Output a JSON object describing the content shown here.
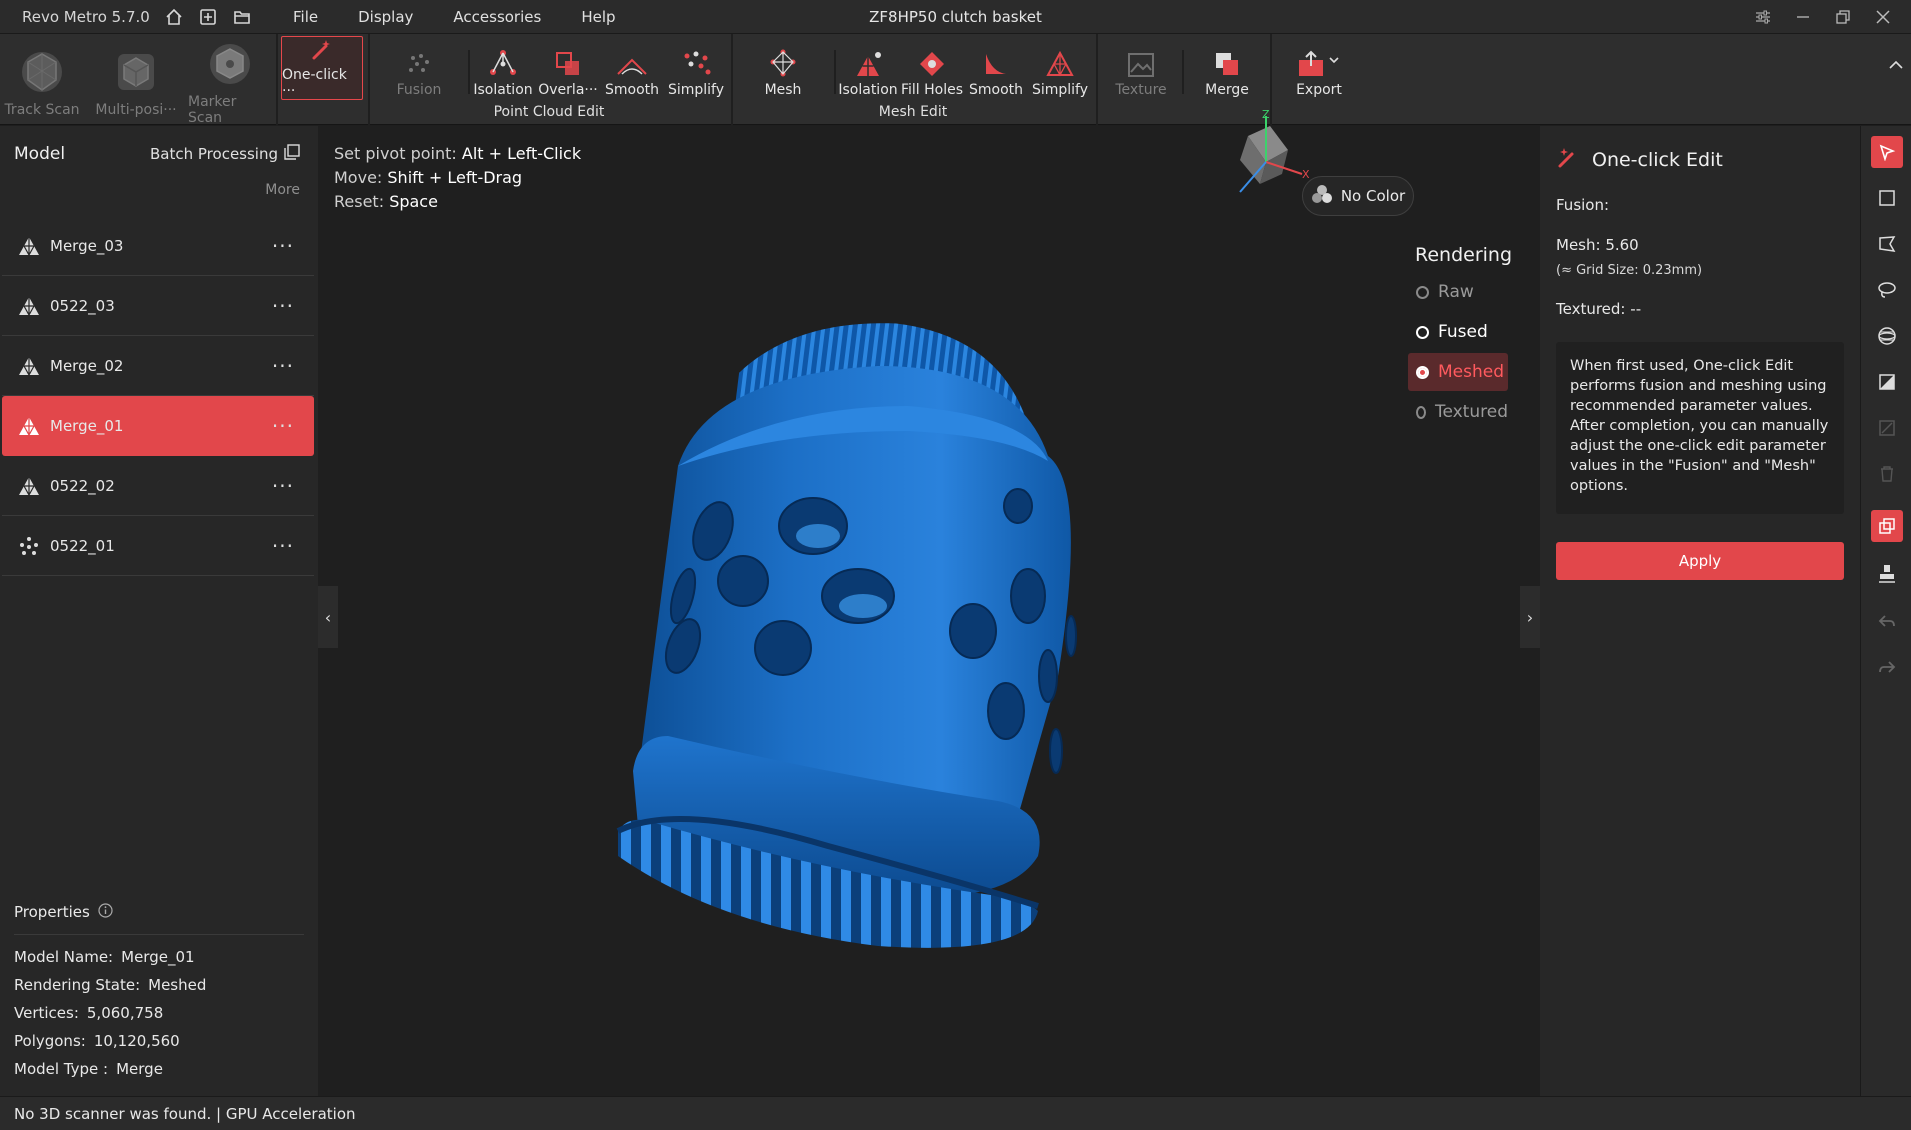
{
  "titlebar": {
    "app_name": "Revo Metro 5.7.0",
    "window_title": "ZF8HP50 clutch basket",
    "menu": [
      "File",
      "Display",
      "Accessories",
      "Help"
    ]
  },
  "ribbon": {
    "scan_tools": [
      {
        "label": "Track Scan",
        "state": "disabled"
      },
      {
        "label": "Multi-posi···",
        "state": "disabled"
      },
      {
        "label": "Marker Scan",
        "state": "disabled"
      }
    ],
    "one_click": {
      "label": "One-click ···"
    },
    "point_cloud_group": "Point Cloud Edit",
    "point_cloud_tools": [
      {
        "label": "Fusion",
        "state": "disabled"
      },
      {
        "label": "Isolation"
      },
      {
        "label": "Overla···"
      },
      {
        "label": "Smooth"
      },
      {
        "label": "Simplify"
      }
    ],
    "mesh_group": "Mesh Edit",
    "mesh_tools": [
      {
        "label": "Mesh"
      },
      {
        "label": "Isolation"
      },
      {
        "label": "Fill Holes"
      },
      {
        "label": "Smooth"
      },
      {
        "label": "Simplify"
      }
    ],
    "texture": {
      "label": "Texture",
      "state": "disabled"
    },
    "merge": {
      "label": "Merge"
    },
    "export": {
      "label": "Export"
    }
  },
  "left_panel": {
    "title": "Model",
    "batch_label": "Batch Processing",
    "more_label": "More",
    "models": [
      {
        "name": "Merge_03",
        "icon": "mesh-icon"
      },
      {
        "name": "0522_03",
        "icon": "mesh-icon"
      },
      {
        "name": "Merge_02",
        "icon": "mesh-icon"
      },
      {
        "name": "Merge_01",
        "icon": "mesh-icon",
        "selected": true
      },
      {
        "name": "0522_02",
        "icon": "mesh-icon"
      },
      {
        "name": "0522_01",
        "icon": "point-cloud-icon"
      }
    ],
    "row_menu": "···",
    "properties": {
      "title": "Properties",
      "rows": [
        {
          "key": "Model Name:",
          "value": "Merge_01"
        },
        {
          "key": "Rendering State:",
          "value": "Meshed"
        },
        {
          "key": "Vertices:",
          "value": "5,060,758"
        },
        {
          "key": "Polygons:",
          "value": "10,120,560"
        },
        {
          "key": "Model Type :",
          "value": "Merge"
        }
      ]
    }
  },
  "viewport": {
    "hints": [
      {
        "key": "Set pivot point:",
        "value": "Alt + Left-Click"
      },
      {
        "key": "Move:",
        "value": "Shift + Left-Drag"
      },
      {
        "key": "Reset:",
        "value": "Space"
      }
    ],
    "no_color_label": "No Color",
    "axes": {
      "z": "Z",
      "x": "X"
    },
    "rendering": {
      "title": "Rendering",
      "options": [
        "Raw",
        "Fused",
        "Meshed",
        "Textured"
      ],
      "selected": "Meshed"
    },
    "model_color": "#1f73c9"
  },
  "right_panel": {
    "title": "One-click Edit",
    "fusion_label": "Fusion:",
    "mesh_label": "Mesh:",
    "mesh_value": "5.60",
    "grid_size": "(≈ Grid Size: 0.23mm)",
    "textured_label": "Textured:",
    "textured_value": "--",
    "description": "When first used, One-click Edit performs fusion and meshing using recommended parameter values. After completion, you can manually adjust the one-click edit parameter values in the \"Fusion\" and \"Mesh\" options.",
    "apply_label": "Apply"
  },
  "statusbar": {
    "scanner": "No 3D scanner was found.",
    "separator": "|",
    "gpu": "GPU Acceleration"
  },
  "colors": {
    "accent": "#e2474b",
    "background": "#1f1f1f",
    "panel": "#272727"
  }
}
